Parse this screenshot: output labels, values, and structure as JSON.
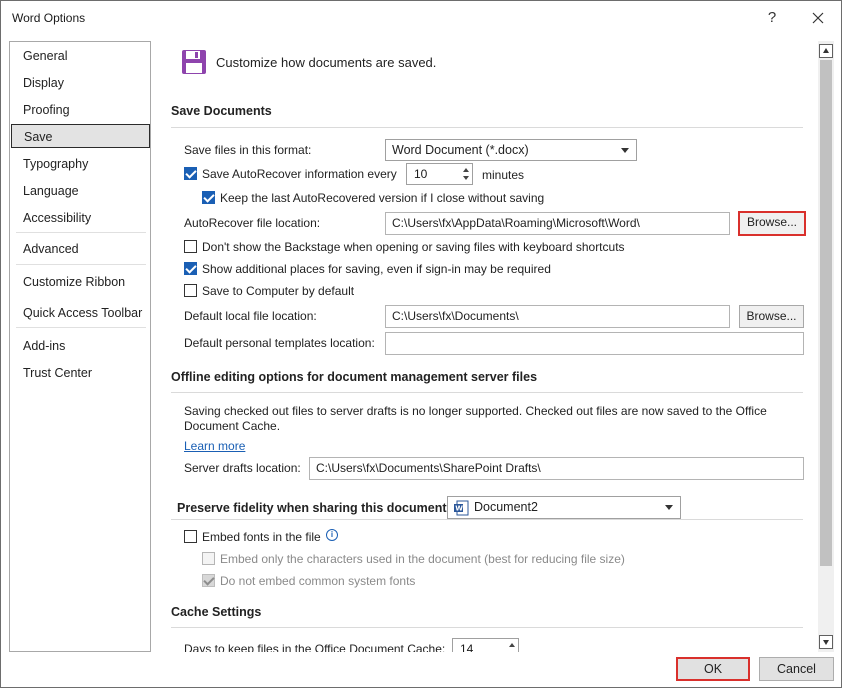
{
  "window": {
    "title": "Word Options",
    "help_glyph": "?",
    "close_icon": "close-icon"
  },
  "sidebar": {
    "items": [
      {
        "label": "General",
        "selected": false
      },
      {
        "label": "Display",
        "selected": false
      },
      {
        "label": "Proofing",
        "selected": false
      },
      {
        "label": "Save",
        "selected": true
      },
      {
        "label": "Typography",
        "selected": false
      },
      {
        "label": "Language",
        "selected": false
      },
      {
        "label": "Accessibility",
        "selected": false
      },
      {
        "label": "Advanced",
        "selected": false
      },
      {
        "label": "Customize Ribbon",
        "selected": false
      },
      {
        "label": "Quick Access Toolbar",
        "selected": false
      },
      {
        "label": "Add-ins",
        "selected": false
      },
      {
        "label": "Trust Center",
        "selected": false
      }
    ]
  },
  "header": {
    "text": "Customize how documents are saved.",
    "icon": "save-icon",
    "icon_color": "#8e44ad"
  },
  "save_documents": {
    "title": "Save Documents",
    "format_label": "Save files in this format:",
    "format_value": "Word Document (*.docx)",
    "autorecover_label": "Save AutoRecover information every",
    "autorecover_checked": true,
    "autorecover_minutes": "10",
    "minutes_label": "minutes",
    "keep_last_label": "Keep the last AutoRecovered version if I close without saving",
    "keep_last_checked": true,
    "autorecover_location_label": "AutoRecover file location:",
    "autorecover_location_value": "C:\\Users\\fx\\AppData\\Roaming\\Microsoft\\Word\\",
    "browse_label": "Browse...",
    "backstage_label": "Don't show the Backstage when opening or saving files with keyboard shortcuts",
    "backstage_checked": false,
    "additional_places_label": "Show additional places for saving, even if sign-in may be required",
    "additional_places_checked": true,
    "save_to_computer_label": "Save to Computer by default",
    "save_to_computer_checked": false,
    "default_local_label": "Default local file location:",
    "default_local_value": "C:\\Users\\fx\\Documents\\",
    "browse2_label": "Browse...",
    "templates_label": "Default personal templates location:",
    "templates_value": ""
  },
  "offline": {
    "title": "Offline editing options for document management server files",
    "message_line1": "Saving checked out files to server drafts is no longer supported. Checked out files are now saved to the Office",
    "message_line2": "Document Cache.",
    "learn_more": "Learn more",
    "server_drafts_label": "Server drafts location:",
    "server_drafts_value": "C:\\Users\\fx\\Documents\\SharePoint Drafts\\"
  },
  "fidelity": {
    "title": "Preserve fidelity when sharing this document:",
    "document_value": "Document2",
    "embed_fonts_label": "Embed fonts in the file",
    "embed_fonts_checked": false,
    "embed_only_label": "Embed only the characters used in the document (best for reducing file size)",
    "embed_only_checked": false,
    "no_common_label": "Do not embed common system fonts",
    "no_common_checked": true
  },
  "cache": {
    "title": "Cache Settings",
    "days_label": "Days to keep files in the Office Document Cache:",
    "days_value": "14"
  },
  "footer": {
    "ok_label": "OK",
    "cancel_label": "Cancel"
  },
  "colors": {
    "accent": "#1a5fb4",
    "highlight": "#d9302c"
  }
}
